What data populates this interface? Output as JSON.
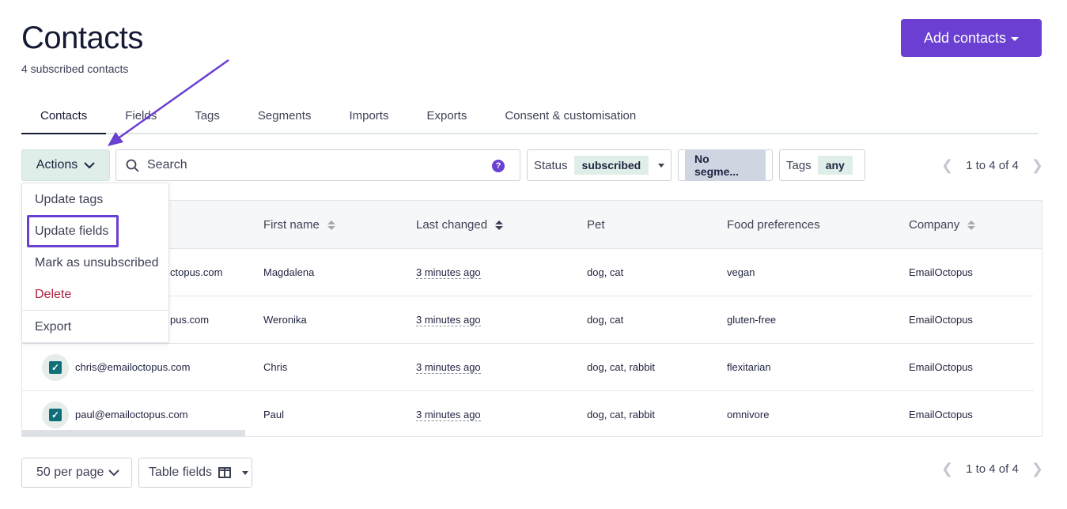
{
  "header": {
    "title": "Contacts",
    "subtitle": "4 subscribed contacts",
    "add_button_label": "Add contacts"
  },
  "tabs": [
    {
      "label": "Contacts",
      "active": true
    },
    {
      "label": "Fields"
    },
    {
      "label": "Tags"
    },
    {
      "label": "Segments"
    },
    {
      "label": "Imports"
    },
    {
      "label": "Exports"
    },
    {
      "label": "Consent & customisation"
    }
  ],
  "toolbar": {
    "actions_label": "Actions",
    "search_placeholder": "Search",
    "help_glyph": "?",
    "status_label": "Status",
    "status_value": "subscribed",
    "segment_value": "No segme...",
    "tags_label": "Tags",
    "tags_value": "any"
  },
  "pagination": {
    "range_text": "1 to 4 of 4"
  },
  "actions_menu": {
    "items": [
      {
        "label": "Update tags"
      },
      {
        "label": "Update fields",
        "highlighted": true
      },
      {
        "label": "Mark as unsubscribed"
      },
      {
        "label": "Delete"
      },
      {
        "label": "Export"
      }
    ]
  },
  "table": {
    "columns": [
      "First name",
      "Last changed",
      "Pet",
      "Food preferences",
      "Company"
    ],
    "rows": [
      {
        "email_visible": "ctopus.com",
        "first_name": "Magdalena",
        "last_changed": "3 minutes ago",
        "pet": "dog, cat",
        "food": "vegan",
        "company": "EmailOctopus",
        "checked": true
      },
      {
        "email_visible": "pus.com",
        "first_name": "Weronika",
        "last_changed": "3 minutes ago",
        "pet": "dog, cat",
        "food": "gluten-free",
        "company": "EmailOctopus",
        "checked": true
      },
      {
        "email_visible": "chris@emailoctopus.com",
        "first_name": "Chris",
        "last_changed": "3 minutes ago",
        "pet": "dog, cat, rabbit",
        "food": "flexitarian",
        "company": "EmailOctopus",
        "checked": true
      },
      {
        "email_visible": "paul@emailoctopus.com",
        "first_name": "Paul",
        "last_changed": "3 minutes ago",
        "pet": "dog, cat, rabbit",
        "food": "omnivore",
        "company": "EmailOctopus",
        "checked": true
      }
    ]
  },
  "footer": {
    "per_page_label": "50 per page",
    "table_fields_label": "Table fields"
  },
  "colors": {
    "accent": "#6a3fd1",
    "actions_bg": "#dfeee8",
    "checkbox": "#0f6f78",
    "delete": "#b0203f"
  }
}
